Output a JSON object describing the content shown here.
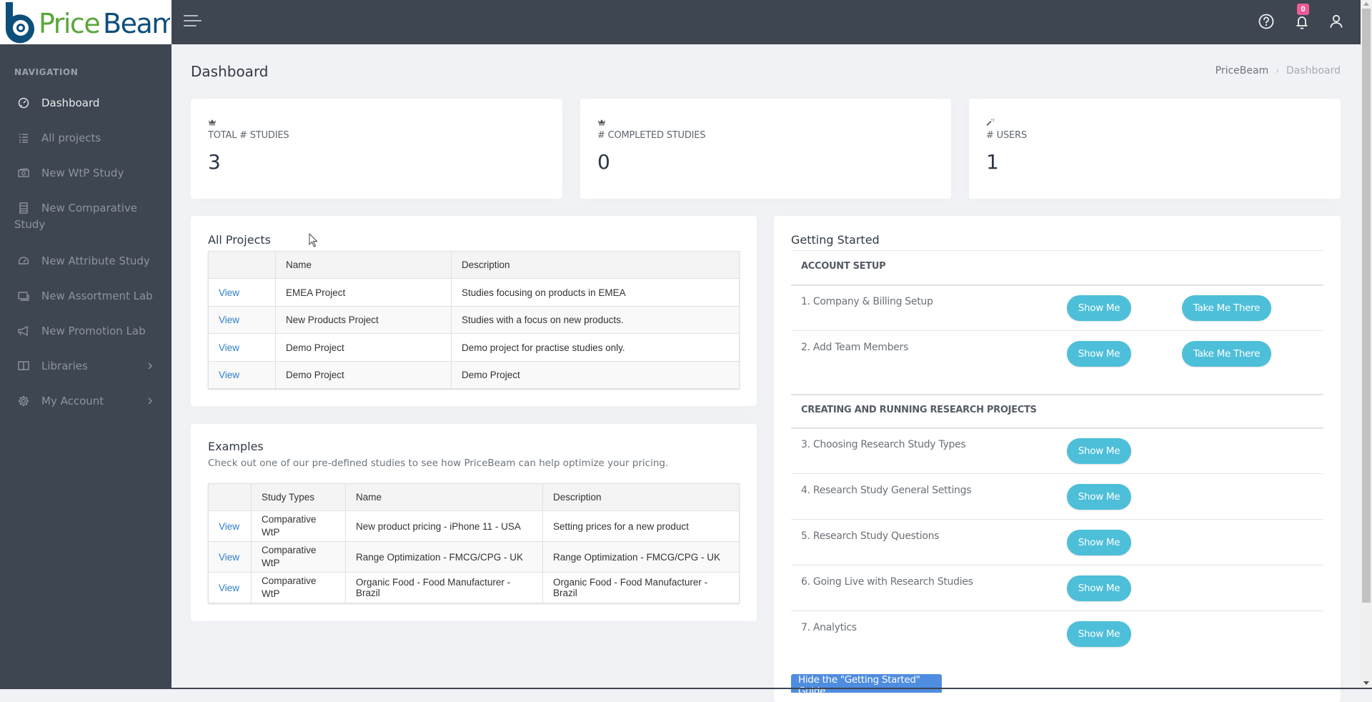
{
  "brand": {
    "logo_text_1": "Price",
    "logo_text_2": "Beam",
    "colors": {
      "logo_blue": "#0d4f7a",
      "logo_green": "#5aa63a",
      "topbar": "#3e4651",
      "accent_button": "#4dbfd9",
      "link": "#2f7ec8",
      "badge": "#ee5b95",
      "primary_button": "#4f8de0"
    }
  },
  "topbar": {
    "menu_icon": "hamburger-icon",
    "help_icon": "help-circle-icon",
    "notifications_icon": "bell-icon",
    "notifications_count": "0",
    "user_icon": "user-icon"
  },
  "sidebar": {
    "section_title": "NAVIGATION",
    "items": [
      {
        "label": "Dashboard",
        "icon": "dashboard-gauge-icon",
        "active": true
      },
      {
        "label": "All projects",
        "icon": "list-icon"
      },
      {
        "label": "New WtP Study",
        "icon": "money-icon"
      },
      {
        "label": "New Comparative Study",
        "icon": "columns-icon"
      },
      {
        "label": "New Attribute Study",
        "icon": "speedometer-icon"
      },
      {
        "label": "New Assortment Lab",
        "icon": "layers-icon"
      },
      {
        "label": "New Promotion Lab",
        "icon": "megaphone-icon"
      },
      {
        "label": "Libraries",
        "icon": "book-icon",
        "has_submenu": true
      },
      {
        "label": "My Account",
        "icon": "gear-icon",
        "has_submenu": true
      }
    ]
  },
  "page": {
    "title": "Dashboard",
    "breadcrumb": [
      "PriceBeam",
      "Dashboard"
    ]
  },
  "stats": [
    {
      "icon": "crown-icon",
      "label": "TOTAL # STUDIES",
      "value": "3"
    },
    {
      "icon": "crown-icon",
      "label": "# COMPLETED STUDIES",
      "value": "0"
    },
    {
      "icon": "magic-wand-icon",
      "label": "# USERS",
      "value": "1"
    }
  ],
  "all_projects": {
    "title": "All Projects",
    "columns": [
      "",
      "Name",
      "Description"
    ],
    "rows": [
      {
        "action": "View",
        "name": "EMEA Project",
        "description": "Studies focusing on products in EMEA"
      },
      {
        "action": "View",
        "name": "New Products Project",
        "description": "Studies with a focus on new products."
      },
      {
        "action": "View",
        "name": "Demo Project",
        "description": "Demo project for practise studies only."
      },
      {
        "action": "View",
        "name": "Demo Project",
        "description": "Demo Project"
      }
    ]
  },
  "examples": {
    "title": "Examples",
    "subtitle": "Check out one of our pre-defined studies to see how PriceBeam can help optimize your pricing.",
    "columns": [
      "",
      "Study Types",
      "Name",
      "Description"
    ],
    "rows": [
      {
        "action": "View",
        "study_type": "Comparative WtP",
        "name": "New product pricing - iPhone 11 - USA",
        "description": "Setting prices for a new product"
      },
      {
        "action": "View",
        "study_type": "Comparative WtP",
        "name": "Range Optimization - FMCG/CPG - UK",
        "description": "Range Optimization - FMCG/CPG - UK"
      },
      {
        "action": "View",
        "study_type": "Comparative WtP",
        "name": "Organic Food - Food Manufacturer - Brazil",
        "description": "Organic Food - Food Manufacturer - Brazil"
      }
    ]
  },
  "getting_started": {
    "title": "Getting Started",
    "sections": [
      {
        "heading": "ACCOUNT SETUP",
        "items": [
          {
            "label": "1. Company & Billing Setup",
            "show_me": "Show Me",
            "take_me_there": "Take Me There"
          },
          {
            "label": "2. Add Team Members",
            "show_me": "Show Me",
            "take_me_there": "Take Me There"
          }
        ]
      },
      {
        "heading": "CREATING AND RUNNING RESEARCH PROJECTS",
        "items": [
          {
            "label": "3. Choosing Research Study Types",
            "show_me": "Show Me"
          },
          {
            "label": "4. Research Study General Settings",
            "show_me": "Show Me"
          },
          {
            "label": "5. Research Study Questions",
            "show_me": "Show Me"
          },
          {
            "label": "6. Going Live with Research Studies",
            "show_me": "Show Me"
          },
          {
            "label": "7. Analytics",
            "show_me": "Show Me"
          }
        ]
      }
    ],
    "hide_button": "Hide the \"Getting Started\" Guide"
  }
}
